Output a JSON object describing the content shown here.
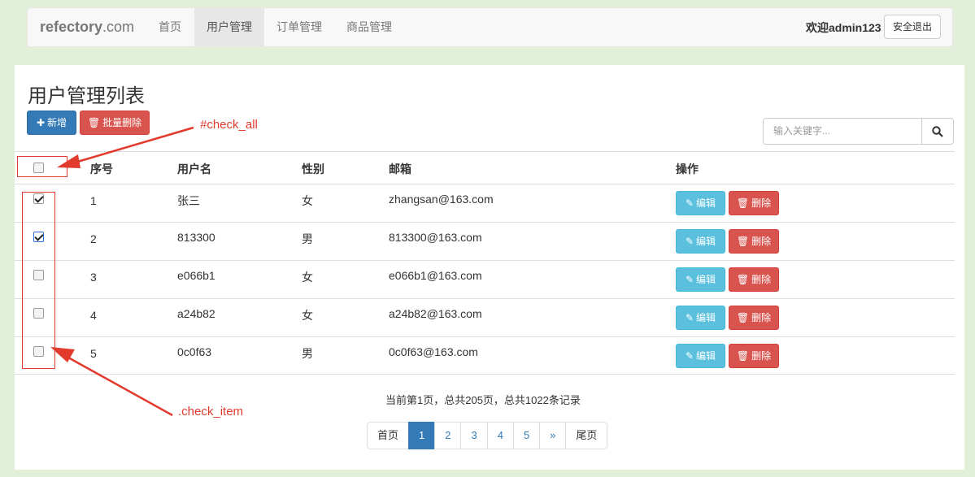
{
  "navbar": {
    "brand_main": "refectory",
    "brand_suffix": ".com",
    "items": [
      {
        "label": "首页",
        "active": false
      },
      {
        "label": "用户管理",
        "active": true
      },
      {
        "label": "订单管理",
        "active": false
      },
      {
        "label": "商品管理",
        "active": false
      }
    ],
    "welcome": "欢迎admin123",
    "logout_label": "安全退出"
  },
  "main": {
    "title": "用户管理列表",
    "add_label": "新增",
    "batch_delete_label": "批量删除",
    "search_placeholder": "输入关键字...",
    "columns": [
      "序号",
      "用户名",
      "性别",
      "邮箱",
      "操作"
    ],
    "rows": [
      {
        "id": "1",
        "username": "张三",
        "gender": "女",
        "email": "zhangsan@163.com",
        "checked": true
      },
      {
        "id": "2",
        "username": "813300",
        "gender": "男",
        "email": "813300@163.com",
        "checked": true
      },
      {
        "id": "3",
        "username": "e066b1",
        "gender": "女",
        "email": "e066b1@163.com",
        "checked": false
      },
      {
        "id": "4",
        "username": "a24b82",
        "gender": "女",
        "email": "a24b82@163.com",
        "checked": false
      },
      {
        "id": "5",
        "username": "0c0f63",
        "gender": "男",
        "email": "0c0f63@163.com",
        "checked": false
      }
    ],
    "edit_label": "编辑",
    "delete_label": "删除",
    "summary": "当前第1页，总共205页，总共1022条记录",
    "pagination": {
      "first": "首页",
      "pages": [
        "1",
        "2",
        "3",
        "4",
        "5"
      ],
      "current": "1",
      "next": "»",
      "last": "尾页"
    }
  },
  "annotations": {
    "check_all": "#check_all",
    "check_item": ".check_item",
    "color": "#e23b2e"
  },
  "colors": {
    "primary": "#337ab7",
    "danger": "#d9534f",
    "info": "#5bc0de",
    "background": "#e2f0d9"
  }
}
